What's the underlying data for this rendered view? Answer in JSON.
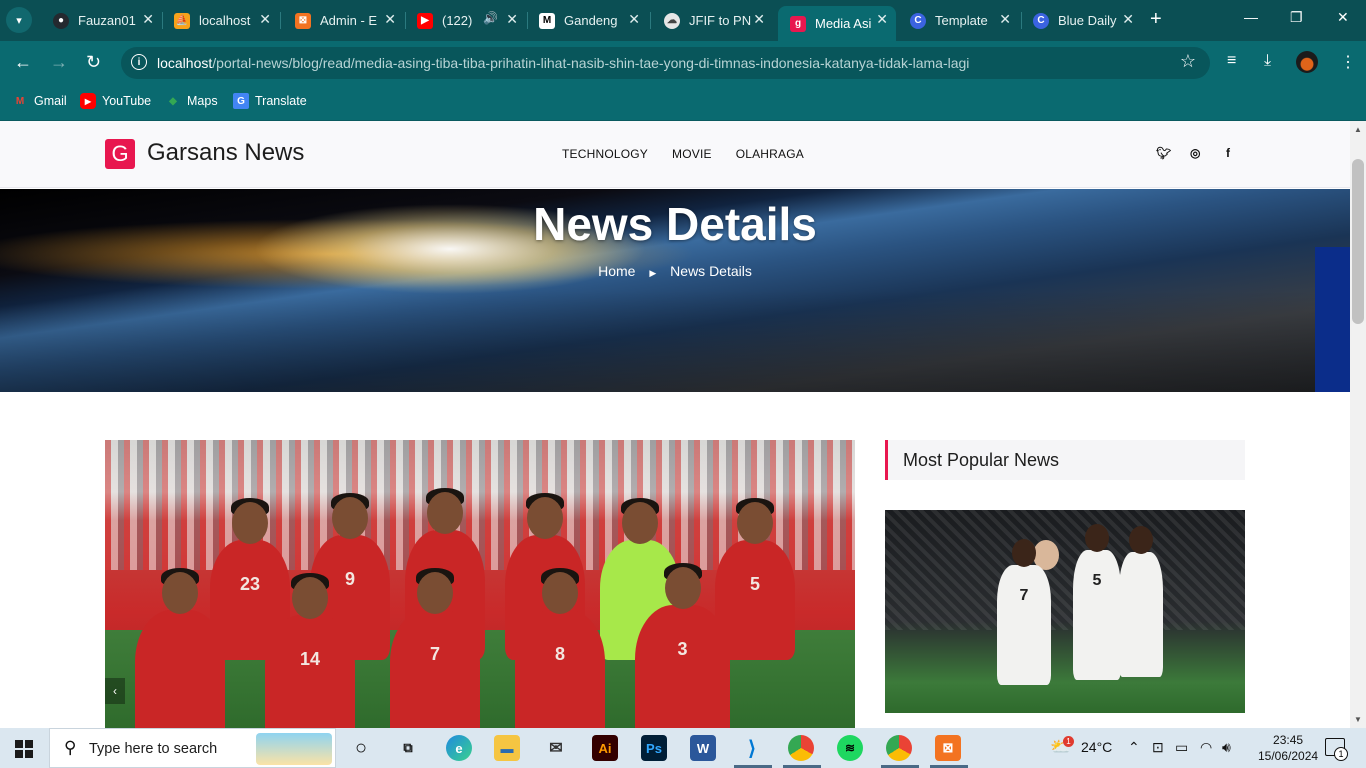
{
  "browser": {
    "tabs": [
      {
        "title": "Fauzan01",
        "icon": "github-icon",
        "color": "#24292f"
      },
      {
        "title": "localhost",
        "icon": "phpmyadmin-icon",
        "color": "#f39c12"
      },
      {
        "title": "Admin - E",
        "icon": "xampp-icon",
        "color": "#f37321"
      },
      {
        "title": "(122)",
        "icon": "youtube-icon",
        "color": "#ff0000",
        "audio": true
      },
      {
        "title": "Gandeng",
        "icon": "medium-icon",
        "color": "#000000"
      },
      {
        "title": "JFIF to PN",
        "icon": "converter-icon",
        "color": "#ffffff"
      },
      {
        "title": "Media Asi",
        "icon": "garsans-icon",
        "color": "#e8174f",
        "active": true
      },
      {
        "title": "Template",
        "icon": "canva-icon",
        "color": "#00c4cc"
      },
      {
        "title": "Blue Daily",
        "icon": "canva-icon",
        "color": "#00c4cc"
      }
    ],
    "url_host": "localhost",
    "url_path": "/portal-news/blog/read/media-asing-tiba-tiba-prihatin-lihat-nasib-shin-tae-yong-di-timnas-indonesia-katanya-tidak-lama-lagi",
    "bookmarks": [
      {
        "label": "Gmail",
        "icon": "gmail-icon"
      },
      {
        "label": "YouTube",
        "icon": "youtube-icon"
      },
      {
        "label": "Maps",
        "icon": "maps-icon"
      },
      {
        "label": "Translate",
        "icon": "translate-icon"
      }
    ]
  },
  "site": {
    "logo_letter": "G",
    "name": "Garsans News",
    "nav": [
      "TECHNOLOGY",
      "MOVIE",
      "OLAHRAGA"
    ],
    "social": [
      {
        "icon": "twitter-icon",
        "glyph": "🐦"
      },
      {
        "icon": "instagram-icon",
        "glyph": "◎"
      },
      {
        "icon": "facebook-icon",
        "glyph": "f"
      }
    ],
    "accent": "#e8174f"
  },
  "hero": {
    "title": "News Details",
    "breadcrumb_home": "Home",
    "breadcrumb_current": "News Details"
  },
  "featured": {
    "jersey_numbers": [
      "23",
      "9",
      "5",
      "14",
      "7",
      "8",
      "3"
    ]
  },
  "sidebar": {
    "heading": "Most Popular News",
    "popular_image_numbers": [
      "7",
      "5"
    ]
  },
  "taskbar": {
    "search_placeholder": "Type here to search",
    "weather_temp": "24°C",
    "weather_badge": "1",
    "time": "23:45",
    "date": "15/06/2024",
    "notification_count": "1"
  }
}
